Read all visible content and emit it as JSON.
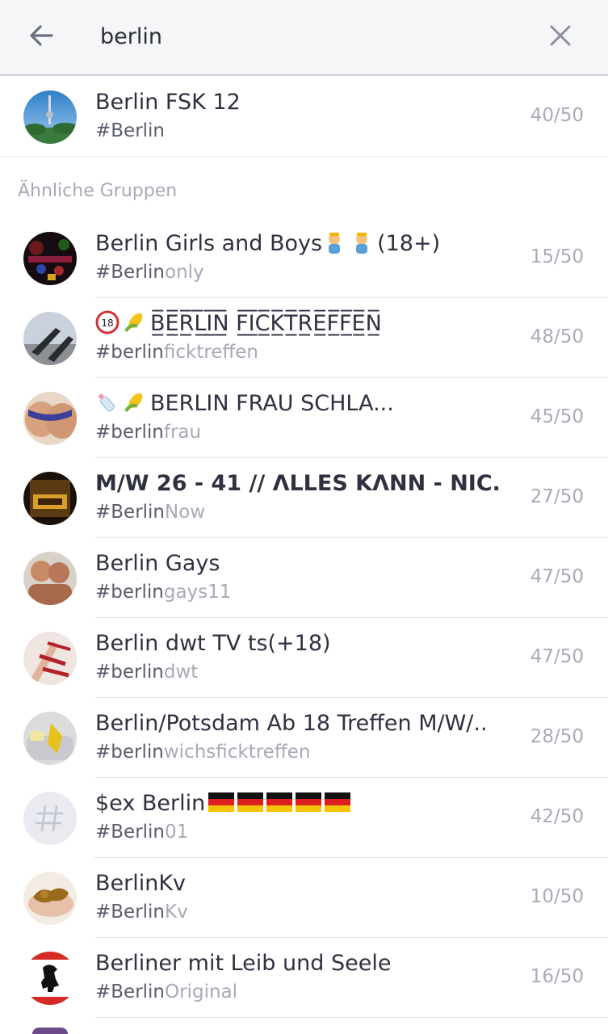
{
  "search": {
    "query": "berlin"
  },
  "top_result": {
    "title": "Berlin FSK 12",
    "tag": "#Berlin",
    "count": "40/50"
  },
  "section_label": "Ähnliche Gruppen",
  "groups": [
    {
      "title": "Berlin Girls and Boys",
      "title_suffix": "(18+)",
      "tag_match": "#Berlin",
      "tag_rest": "only",
      "count": "15/50"
    },
    {
      "title": "B̲̅E̲̅R̲̅L̲̅I̲̅N̲̅ F̲̅I̲̅C̲̅K̲̅T̲̅R̲̅E̲̅F̲̅F̲̅E̲̅N̲̅",
      "tag_match": "#berlin",
      "tag_rest": "ficktreffen",
      "count": "48/50"
    },
    {
      "title": "BERLIN FRAU SCHLA...",
      "tag_match": "#berlin",
      "tag_rest": "frau",
      "count": "45/50"
    },
    {
      "title": "M/W 26 - 41 // ΛLLES KΛNN - NIC..",
      "tag_match": "#Berlin",
      "tag_rest": "Now",
      "count": "27/50"
    },
    {
      "title": "Berlin Gays",
      "tag_match": "#berlin",
      "tag_rest": "gays11",
      "count": "47/50"
    },
    {
      "title": "Berlin dwt TV ts(+18)",
      "tag_match": "#berlin",
      "tag_rest": "dwt",
      "count": "47/50"
    },
    {
      "title": "Berlin/Potsdam Ab 18 Treffen M/W/..",
      "tag_match": "#berlin",
      "tag_rest": "wichsficktreffen",
      "count": "28/50"
    },
    {
      "title": "$ex Berlin",
      "tag_match": "#Berlin",
      "tag_rest": "01",
      "count": "42/50"
    },
    {
      "title": "BerlinKv",
      "tag_match": "#Berlin",
      "tag_rest": "Kv",
      "count": "10/50"
    },
    {
      "title": "Berliner mit Leib und Seele",
      "tag_match": "#Berlin",
      "tag_rest": "Original",
      "count": "16/50"
    }
  ],
  "colors": {
    "accent_text": "#2f3140",
    "muted": "#a7a9b6",
    "topbar": "#f5f6f8"
  },
  "icons": [
    "back-arrow-icon",
    "close-icon",
    "hashtag-icon",
    "german-flag-icon"
  ]
}
